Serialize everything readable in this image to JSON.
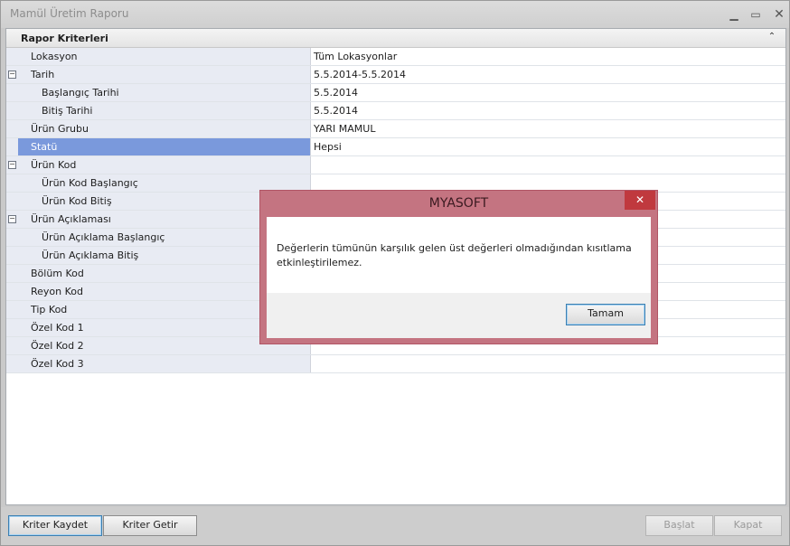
{
  "window": {
    "title": "Mamül Üretim Raporu",
    "controls": {
      "minimize": "▁",
      "maximize": "▭",
      "close": "✕"
    }
  },
  "panel": {
    "title": "Rapor Kriterleri",
    "collapse_icon": "⌃"
  },
  "grid": {
    "rows": [
      {
        "name": "Lokasyon",
        "value": "Tüm Lokasyonlar",
        "level": 0,
        "toggle": ""
      },
      {
        "name": "Tarih",
        "value": "5.5.2014-5.5.2014",
        "level": 0,
        "toggle": "−"
      },
      {
        "name": "Başlangıç Tarihi",
        "value": "5.5.2014",
        "level": 1,
        "toggle": ""
      },
      {
        "name": "Bitiş Tarihi",
        "value": "5.5.2014",
        "level": 1,
        "toggle": ""
      },
      {
        "name": "Ürün Grubu",
        "value": "YARI MAMUL",
        "level": 0,
        "toggle": ""
      },
      {
        "name": "Statü",
        "value": "Hepsi",
        "level": 0,
        "toggle": "",
        "selected": true
      },
      {
        "name": "Ürün Kod",
        "value": "",
        "level": 0,
        "toggle": "−"
      },
      {
        "name": "Ürün Kod Başlangıç",
        "value": "",
        "level": 1,
        "toggle": ""
      },
      {
        "name": "Ürün Kod Bitiş",
        "value": "",
        "level": 1,
        "toggle": ""
      },
      {
        "name": "Ürün Açıklaması",
        "value": "",
        "level": 0,
        "toggle": "−"
      },
      {
        "name": "Ürün Açıklama Başlangıç",
        "value": "",
        "level": 1,
        "toggle": ""
      },
      {
        "name": "Ürün Açıklama Bitiş",
        "value": "",
        "level": 1,
        "toggle": ""
      },
      {
        "name": "Bölüm Kod",
        "value": "",
        "level": 0,
        "toggle": ""
      },
      {
        "name": "Reyon Kod",
        "value": "",
        "level": 0,
        "toggle": ""
      },
      {
        "name": "Tip Kod",
        "value": "",
        "level": 0,
        "toggle": ""
      },
      {
        "name": "Özel Kod 1",
        "value": "",
        "level": 0,
        "toggle": ""
      },
      {
        "name": "Özel Kod 2",
        "value": "",
        "level": 0,
        "toggle": ""
      },
      {
        "name": "Özel Kod 3",
        "value": "",
        "level": 0,
        "toggle": ""
      }
    ]
  },
  "bottom": {
    "save_label": "Kriter Kaydet",
    "load_label": "Kriter Getir",
    "start_label": "Başlat",
    "close_label": "Kapat"
  },
  "dialog": {
    "title": "MYASOFT",
    "close_icon": "✕",
    "message": "Değerlerin tümünün karşılık gelen üst değerleri olmadığından kısıtlama etkinleştirilemez.",
    "ok_label": "Tamam"
  },
  "colors": {
    "dialog_frame": "#c47481",
    "dialog_close": "#c0393e",
    "selected_row": "#7a99dc"
  }
}
